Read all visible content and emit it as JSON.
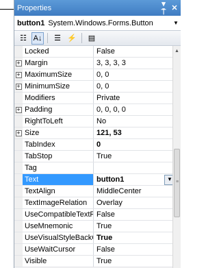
{
  "titlebar": {
    "title": "Properties",
    "pin_glyph": "▾ ⍑",
    "close_glyph": "✕"
  },
  "object_selector": {
    "name": "button1",
    "type": "System.Windows.Forms.Button",
    "drop_glyph": "▼"
  },
  "toolbar": {
    "buttons": [
      {
        "icon": "categorized-icon",
        "glyph": "☷",
        "active": false
      },
      {
        "icon": "alphabetical-icon",
        "glyph": "A↓",
        "active": true
      },
      {
        "icon": "properties-icon",
        "glyph": "☰",
        "active": false
      },
      {
        "icon": "events-icon",
        "glyph": "⚡",
        "active": false
      },
      {
        "icon": "property-pages-icon",
        "glyph": "▤",
        "active": false
      }
    ]
  },
  "properties": [
    {
      "name": "Locked",
      "value": "False",
      "expandable": false,
      "bold": false
    },
    {
      "name": "Margin",
      "value": "3, 3, 3, 3",
      "expandable": true,
      "bold": false
    },
    {
      "name": "MaximumSize",
      "value": "0, 0",
      "expandable": true,
      "bold": false
    },
    {
      "name": "MinimumSize",
      "value": "0, 0",
      "expandable": true,
      "bold": false
    },
    {
      "name": "Modifiers",
      "value": "Private",
      "expandable": false,
      "bold": false
    },
    {
      "name": "Padding",
      "value": "0, 0, 0, 0",
      "expandable": true,
      "bold": false
    },
    {
      "name": "RightToLeft",
      "value": "No",
      "expandable": false,
      "bold": false
    },
    {
      "name": "Size",
      "value": "121, 53",
      "expandable": true,
      "bold": true
    },
    {
      "name": "TabIndex",
      "value": "0",
      "expandable": false,
      "bold": true
    },
    {
      "name": "TabStop",
      "value": "True",
      "expandable": false,
      "bold": false
    },
    {
      "name": "Tag",
      "value": "",
      "expandable": false,
      "bold": false
    },
    {
      "name": "Text",
      "value": "button1",
      "expandable": false,
      "bold": true,
      "selected": true
    },
    {
      "name": "TextAlign",
      "value": "MiddleCenter",
      "expandable": false,
      "bold": false
    },
    {
      "name": "TextImageRelation",
      "value": "Overlay",
      "expandable": false,
      "bold": false
    },
    {
      "name": "UseCompatibleTextRe",
      "value": "False",
      "expandable": false,
      "bold": false
    },
    {
      "name": "UseMnemonic",
      "value": "True",
      "expandable": false,
      "bold": false
    },
    {
      "name": "UseVisualStyleBackCc",
      "value": "True",
      "expandable": false,
      "bold": true
    },
    {
      "name": "UseWaitCursor",
      "value": "False",
      "expandable": false,
      "bold": false
    },
    {
      "name": "Visible",
      "value": "True",
      "expandable": false,
      "bold": false
    }
  ],
  "selected_dropdown_glyph": "▼",
  "scrollbar": {
    "up_glyph": "▲",
    "grip_glyph": "≡"
  },
  "colors": {
    "title_bar": "#4a88cc",
    "selection": "#3399ff"
  }
}
